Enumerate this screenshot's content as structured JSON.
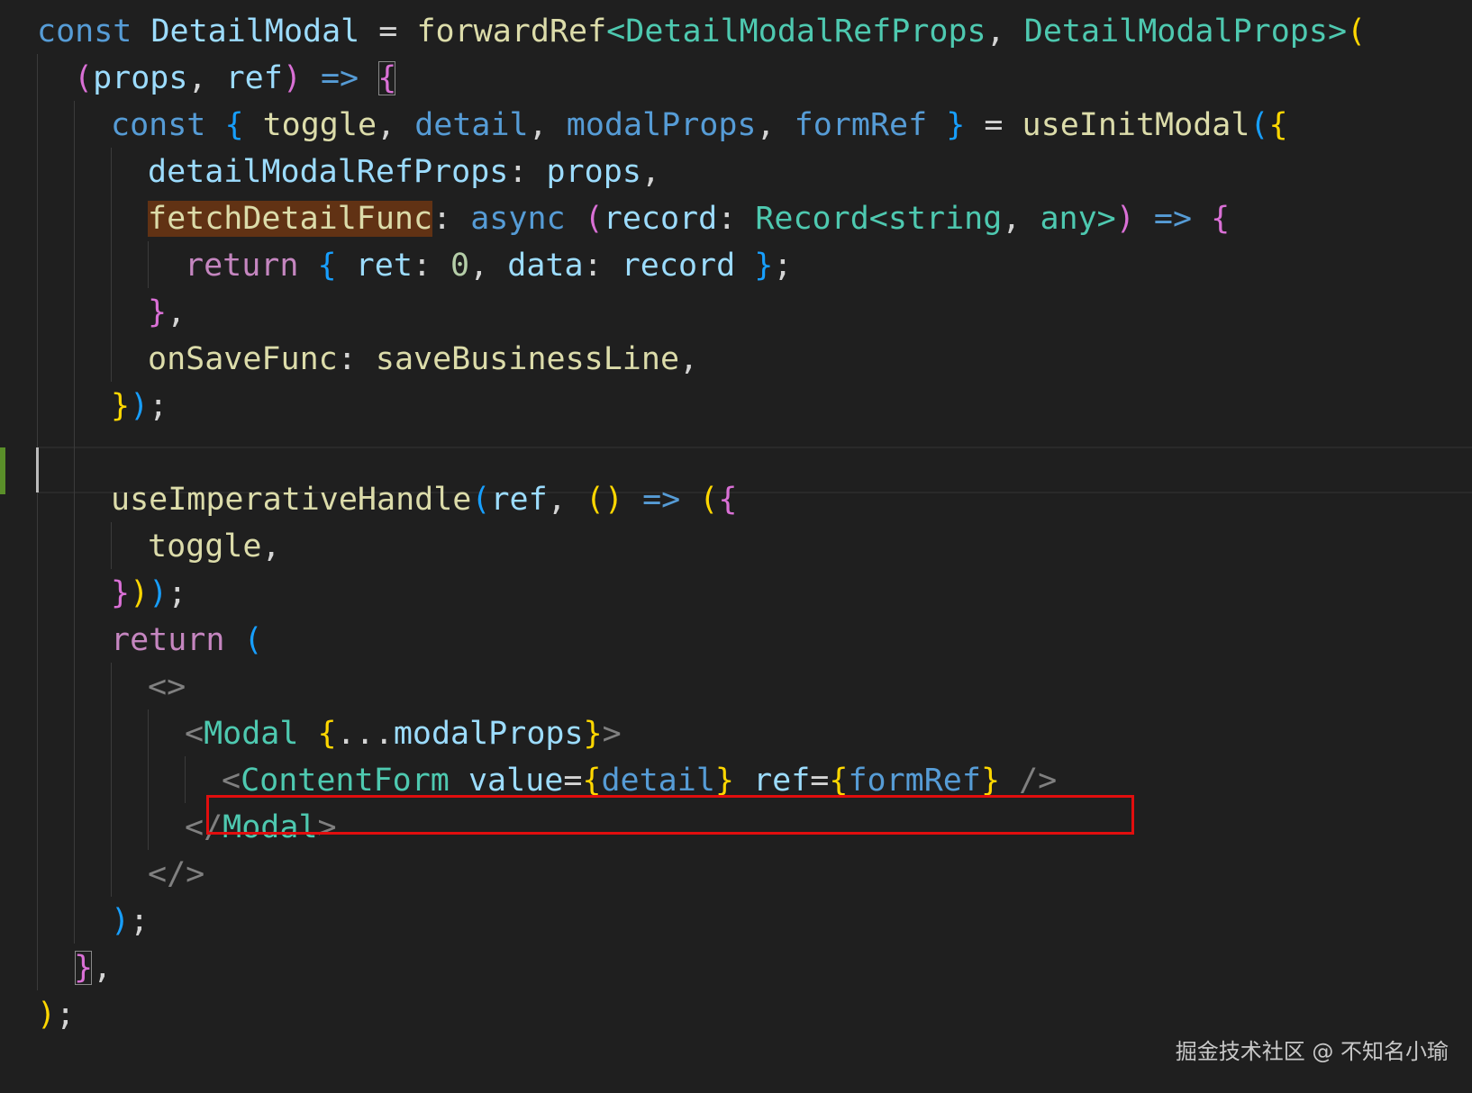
{
  "colors": {
    "background": "#1f1f1f",
    "keyword": "#569cd6",
    "control": "#c586c0",
    "function": "#dcdcaa",
    "variable": "#9cdcfe",
    "type": "#4ec9b0",
    "number": "#b5cea8",
    "punctuation": "#d4d4d4",
    "bracket_gold": "#ffd700",
    "bracket_pink": "#da70d6",
    "bracket_blue": "#179fff",
    "tag_bracket": "#808080",
    "highlight_box": "#e10e0e",
    "word_highlight": "#613214"
  },
  "code_lines": [
    {
      "indent": 0,
      "tokens": [
        {
          "t": "const",
          "c": "keyword"
        },
        {
          "t": " ",
          "c": "punctuation"
        },
        {
          "t": "DetailModal",
          "c": "variable"
        },
        {
          "t": " = ",
          "c": "punctuation"
        },
        {
          "t": "forwardRef",
          "c": "function"
        },
        {
          "t": "<",
          "c": "type"
        },
        {
          "t": "DetailModalRefProps",
          "c": "type"
        },
        {
          "t": ", ",
          "c": "punctuation"
        },
        {
          "t": "DetailModalProps",
          "c": "type"
        },
        {
          "t": ">",
          "c": "type"
        },
        {
          "t": "(",
          "c": "bracket_gold"
        }
      ]
    },
    {
      "indent": 1,
      "tokens": [
        {
          "t": "(",
          "c": "bracket_pink"
        },
        {
          "t": "props",
          "c": "variable"
        },
        {
          "t": ", ",
          "c": "punctuation"
        },
        {
          "t": "ref",
          "c": "variable"
        },
        {
          "t": ")",
          "c": "bracket_pink"
        },
        {
          "t": " ",
          "c": "punctuation"
        },
        {
          "t": "=>",
          "c": "keyword"
        },
        {
          "t": " ",
          "c": "punctuation"
        },
        {
          "t": "{",
          "c": "bracket_pink",
          "boxed": true
        }
      ]
    },
    {
      "indent": 2,
      "tokens": [
        {
          "t": "const",
          "c": "keyword"
        },
        {
          "t": " ",
          "c": "punctuation"
        },
        {
          "t": "{",
          "c": "bracket_blue"
        },
        {
          "t": " ",
          "c": "punctuation"
        },
        {
          "t": "toggle",
          "c": "function"
        },
        {
          "t": ", ",
          "c": "punctuation"
        },
        {
          "t": "detail",
          "c": "keyword"
        },
        {
          "t": ", ",
          "c": "punctuation"
        },
        {
          "t": "modalProps",
          "c": "keyword"
        },
        {
          "t": ", ",
          "c": "punctuation"
        },
        {
          "t": "formRef",
          "c": "keyword"
        },
        {
          "t": " ",
          "c": "punctuation"
        },
        {
          "t": "}",
          "c": "bracket_blue"
        },
        {
          "t": " = ",
          "c": "punctuation"
        },
        {
          "t": "useInitModal",
          "c": "function"
        },
        {
          "t": "(",
          "c": "bracket_blue"
        },
        {
          "t": "{",
          "c": "bracket_gold"
        }
      ]
    },
    {
      "indent": 3,
      "tokens": [
        {
          "t": "detailModalRefProps",
          "c": "variable"
        },
        {
          "t": ": ",
          "c": "punctuation"
        },
        {
          "t": "props",
          "c": "variable"
        },
        {
          "t": ",",
          "c": "punctuation"
        }
      ]
    },
    {
      "indent": 3,
      "tokens": [
        {
          "t": "fetchDetailFunc",
          "c": "function",
          "wordhl": true
        },
        {
          "t": ": ",
          "c": "punctuation"
        },
        {
          "t": "async",
          "c": "keyword"
        },
        {
          "t": " ",
          "c": "punctuation"
        },
        {
          "t": "(",
          "c": "bracket_pink"
        },
        {
          "t": "record",
          "c": "variable"
        },
        {
          "t": ": ",
          "c": "punctuation"
        },
        {
          "t": "Record",
          "c": "type"
        },
        {
          "t": "<",
          "c": "type"
        },
        {
          "t": "string",
          "c": "type"
        },
        {
          "t": ", ",
          "c": "punctuation"
        },
        {
          "t": "any",
          "c": "type"
        },
        {
          "t": ">",
          "c": "type"
        },
        {
          "t": ")",
          "c": "bracket_pink"
        },
        {
          "t": " ",
          "c": "punctuation"
        },
        {
          "t": "=>",
          "c": "keyword"
        },
        {
          "t": " ",
          "c": "punctuation"
        },
        {
          "t": "{",
          "c": "bracket_pink"
        }
      ]
    },
    {
      "indent": 4,
      "tokens": [
        {
          "t": "return",
          "c": "control"
        },
        {
          "t": " ",
          "c": "punctuation"
        },
        {
          "t": "{",
          "c": "bracket_blue"
        },
        {
          "t": " ",
          "c": "punctuation"
        },
        {
          "t": "ret",
          "c": "variable"
        },
        {
          "t": ": ",
          "c": "punctuation"
        },
        {
          "t": "0",
          "c": "number"
        },
        {
          "t": ", ",
          "c": "punctuation"
        },
        {
          "t": "data",
          "c": "variable"
        },
        {
          "t": ": ",
          "c": "punctuation"
        },
        {
          "t": "record",
          "c": "variable"
        },
        {
          "t": " ",
          "c": "punctuation"
        },
        {
          "t": "}",
          "c": "bracket_blue"
        },
        {
          "t": ";",
          "c": "punctuation"
        }
      ]
    },
    {
      "indent": 3,
      "tokens": [
        {
          "t": "}",
          "c": "bracket_pink"
        },
        {
          "t": ",",
          "c": "punctuation"
        }
      ]
    },
    {
      "indent": 3,
      "tokens": [
        {
          "t": "onSaveFunc",
          "c": "function"
        },
        {
          "t": ": ",
          "c": "punctuation"
        },
        {
          "t": "saveBusinessLine",
          "c": "function"
        },
        {
          "t": ",",
          "c": "punctuation"
        }
      ]
    },
    {
      "indent": 2,
      "tokens": [
        {
          "t": "}",
          "c": "bracket_gold"
        },
        {
          "t": ")",
          "c": "bracket_blue"
        },
        {
          "t": ";",
          "c": "punctuation"
        }
      ]
    },
    {
      "indent": 0,
      "tokens": []
    },
    {
      "indent": 2,
      "tokens": [
        {
          "t": "useImperativeHandle",
          "c": "function"
        },
        {
          "t": "(",
          "c": "bracket_blue"
        },
        {
          "t": "ref",
          "c": "variable"
        },
        {
          "t": ", ",
          "c": "punctuation"
        },
        {
          "t": "()",
          "c": "bracket_gold"
        },
        {
          "t": " ",
          "c": "punctuation"
        },
        {
          "t": "=>",
          "c": "keyword"
        },
        {
          "t": " ",
          "c": "punctuation"
        },
        {
          "t": "(",
          "c": "bracket_gold"
        },
        {
          "t": "{",
          "c": "bracket_pink"
        }
      ]
    },
    {
      "indent": 3,
      "tokens": [
        {
          "t": "toggle",
          "c": "function"
        },
        {
          "t": ",",
          "c": "punctuation"
        }
      ]
    },
    {
      "indent": 2,
      "tokens": [
        {
          "t": "}",
          "c": "bracket_pink"
        },
        {
          "t": ")",
          "c": "bracket_gold"
        },
        {
          "t": ")",
          "c": "bracket_blue"
        },
        {
          "t": ";",
          "c": "punctuation"
        }
      ]
    },
    {
      "indent": 2,
      "tokens": [
        {
          "t": "return",
          "c": "control"
        },
        {
          "t": " ",
          "c": "punctuation"
        },
        {
          "t": "(",
          "c": "bracket_blue"
        }
      ]
    },
    {
      "indent": 3,
      "tokens": [
        {
          "t": "<>",
          "c": "tag_bracket"
        }
      ]
    },
    {
      "indent": 4,
      "tokens": [
        {
          "t": "<",
          "c": "tag_bracket"
        },
        {
          "t": "Modal",
          "c": "type"
        },
        {
          "t": " ",
          "c": "punctuation"
        },
        {
          "t": "{",
          "c": "bracket_gold"
        },
        {
          "t": "...",
          "c": "punctuation"
        },
        {
          "t": "modalProps",
          "c": "variable"
        },
        {
          "t": "}",
          "c": "bracket_gold"
        },
        {
          "t": ">",
          "c": "tag_bracket"
        }
      ]
    },
    {
      "indent": 5,
      "tokens": [
        {
          "t": "<",
          "c": "tag_bracket"
        },
        {
          "t": "ContentForm",
          "c": "type"
        },
        {
          "t": " ",
          "c": "punctuation"
        },
        {
          "t": "value",
          "c": "variable"
        },
        {
          "t": "=",
          "c": "punctuation"
        },
        {
          "t": "{",
          "c": "bracket_gold"
        },
        {
          "t": "detail",
          "c": "keyword"
        },
        {
          "t": "}",
          "c": "bracket_gold"
        },
        {
          "t": " ",
          "c": "punctuation"
        },
        {
          "t": "ref",
          "c": "variable"
        },
        {
          "t": "=",
          "c": "punctuation"
        },
        {
          "t": "{",
          "c": "bracket_gold"
        },
        {
          "t": "formRef",
          "c": "keyword"
        },
        {
          "t": "}",
          "c": "bracket_gold"
        },
        {
          "t": " ",
          "c": "punctuation"
        },
        {
          "t": "/>",
          "c": "tag_bracket"
        }
      ]
    },
    {
      "indent": 4,
      "tokens": [
        {
          "t": "</",
          "c": "tag_bracket"
        },
        {
          "t": "Modal",
          "c": "type"
        },
        {
          "t": ">",
          "c": "tag_bracket"
        }
      ]
    },
    {
      "indent": 3,
      "tokens": [
        {
          "t": "</>",
          "c": "tag_bracket"
        }
      ]
    },
    {
      "indent": 2,
      "tokens": [
        {
          "t": ")",
          "c": "bracket_blue"
        },
        {
          "t": ";",
          "c": "punctuation"
        }
      ]
    },
    {
      "indent": 1,
      "tokens": [
        {
          "t": "}",
          "c": "bracket_pink",
          "boxed": true
        },
        {
          "t": ",",
          "c": "punctuation"
        }
      ]
    },
    {
      "indent": 0,
      "tokens": [
        {
          "t": ")",
          "c": "bracket_gold"
        },
        {
          "t": ";",
          "c": "punctuation"
        }
      ]
    }
  ],
  "watermark": "掘金技术社区 @ 不知名小瑜"
}
